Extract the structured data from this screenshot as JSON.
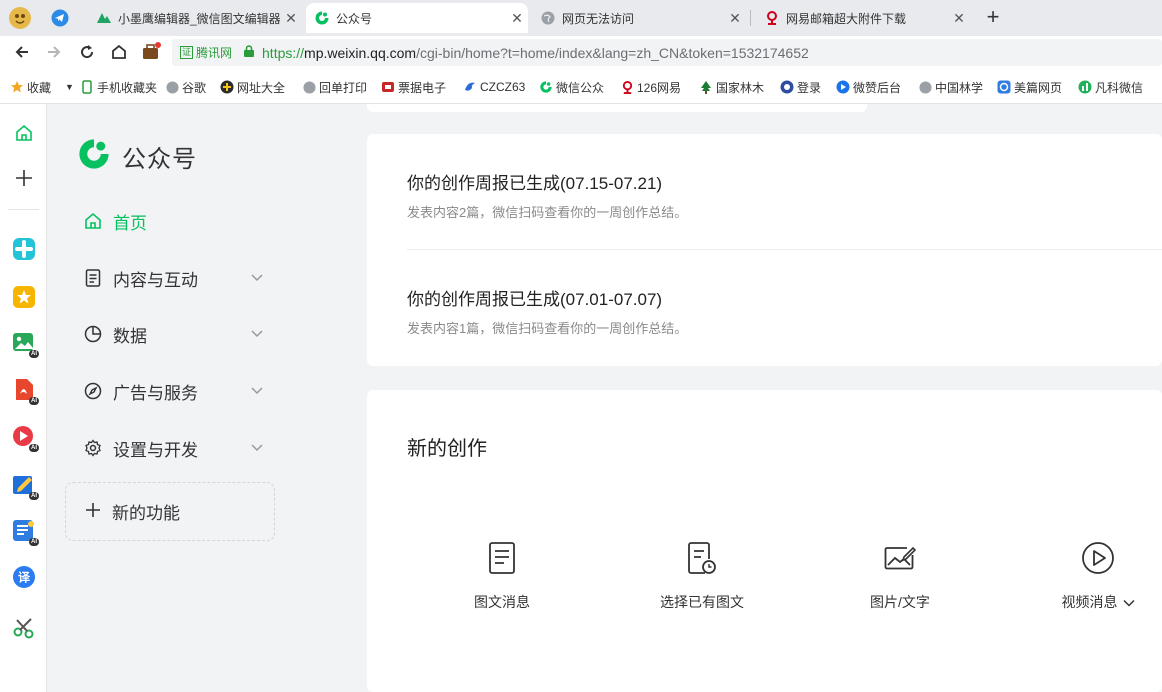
{
  "browser": {
    "tabs": [
      {
        "title": "小墨鹰编辑器_微信图文编辑器",
        "close": "✕",
        "icon": "xiaomoying-icon"
      },
      {
        "title": "公众号",
        "close": "✕",
        "icon": "wechat-mp-icon"
      },
      {
        "title": "网页无法访问",
        "close": "✕",
        "icon": "globe-icon"
      },
      {
        "title": "网易邮箱超大附件下载",
        "close": "✕",
        "icon": "netease-icon"
      }
    ],
    "new_tab": "+",
    "address": {
      "cert_label": "腾讯网",
      "cert_badge": "证",
      "url_scheme": "https://",
      "url_host": "mp.weixin.qq.com",
      "url_path": "/cgi-bin/home?t=home/index&lang=zh_CN&token=1532174652"
    },
    "bookmarks": [
      {
        "label": "收藏",
        "icon": "star-icon"
      },
      {
        "label": "手机收藏夹",
        "icon": "phone-icon"
      },
      {
        "label": "谷歌",
        "icon": "globe-icon"
      },
      {
        "label": "网址大全",
        "icon": "plus-circle-icon"
      },
      {
        "label": "回单打印",
        "icon": "globe-icon"
      },
      {
        "label": "票据电子",
        "icon": "ticket-icon"
      },
      {
        "label": "CZCZ63",
        "icon": "bird-icon"
      },
      {
        "label": "微信公众",
        "icon": "wechat-mp-icon"
      },
      {
        "label": "126网易",
        "icon": "netease-icon"
      },
      {
        "label": "国家林木",
        "icon": "tree-icon"
      },
      {
        "label": "登录",
        "icon": "login-icon"
      },
      {
        "label": "微赞后台",
        "icon": "play-icon"
      },
      {
        "label": "中国林学",
        "icon": "globe-icon"
      },
      {
        "label": "美篇网页",
        "icon": "meipian-icon"
      },
      {
        "label": "凡科微信",
        "icon": "chart-icon"
      }
    ]
  },
  "brand": {
    "name": "公众号"
  },
  "menu": [
    {
      "label": "首页",
      "icon": "home-icon",
      "active": true
    },
    {
      "label": "内容与互动",
      "icon": "document-icon",
      "expandable": true
    },
    {
      "label": "数据",
      "icon": "pie-chart-icon",
      "expandable": true
    },
    {
      "label": "广告与服务",
      "icon": "compass-icon",
      "expandable": true
    },
    {
      "label": "设置与开发",
      "icon": "gear-icon",
      "expandable": true
    }
  ],
  "new_feature": {
    "label": "新的功能",
    "icon": "plus-icon"
  },
  "reports": [
    {
      "title": "你的创作周报已生成(07.15-07.21)",
      "desc": "发表内容2篇，微信扫码查看你的一周创作总结。"
    },
    {
      "title": "你的创作周报已生成(07.01-07.07)",
      "desc": "发表内容1篇，微信扫码查看你的一周创作总结。"
    }
  ],
  "create": {
    "title": "新的创作",
    "items": [
      {
        "label": "图文消息",
        "icon": "article-icon"
      },
      {
        "label": "选择已有图文",
        "icon": "article-clock-icon"
      },
      {
        "label": "图片/文字",
        "icon": "image-edit-icon"
      },
      {
        "label": "视频消息",
        "icon": "video-play-icon",
        "has_dropdown": true
      }
    ]
  },
  "colors": {
    "accent": "#07c160",
    "background": "#f2f3f5",
    "card": "#ffffff"
  }
}
